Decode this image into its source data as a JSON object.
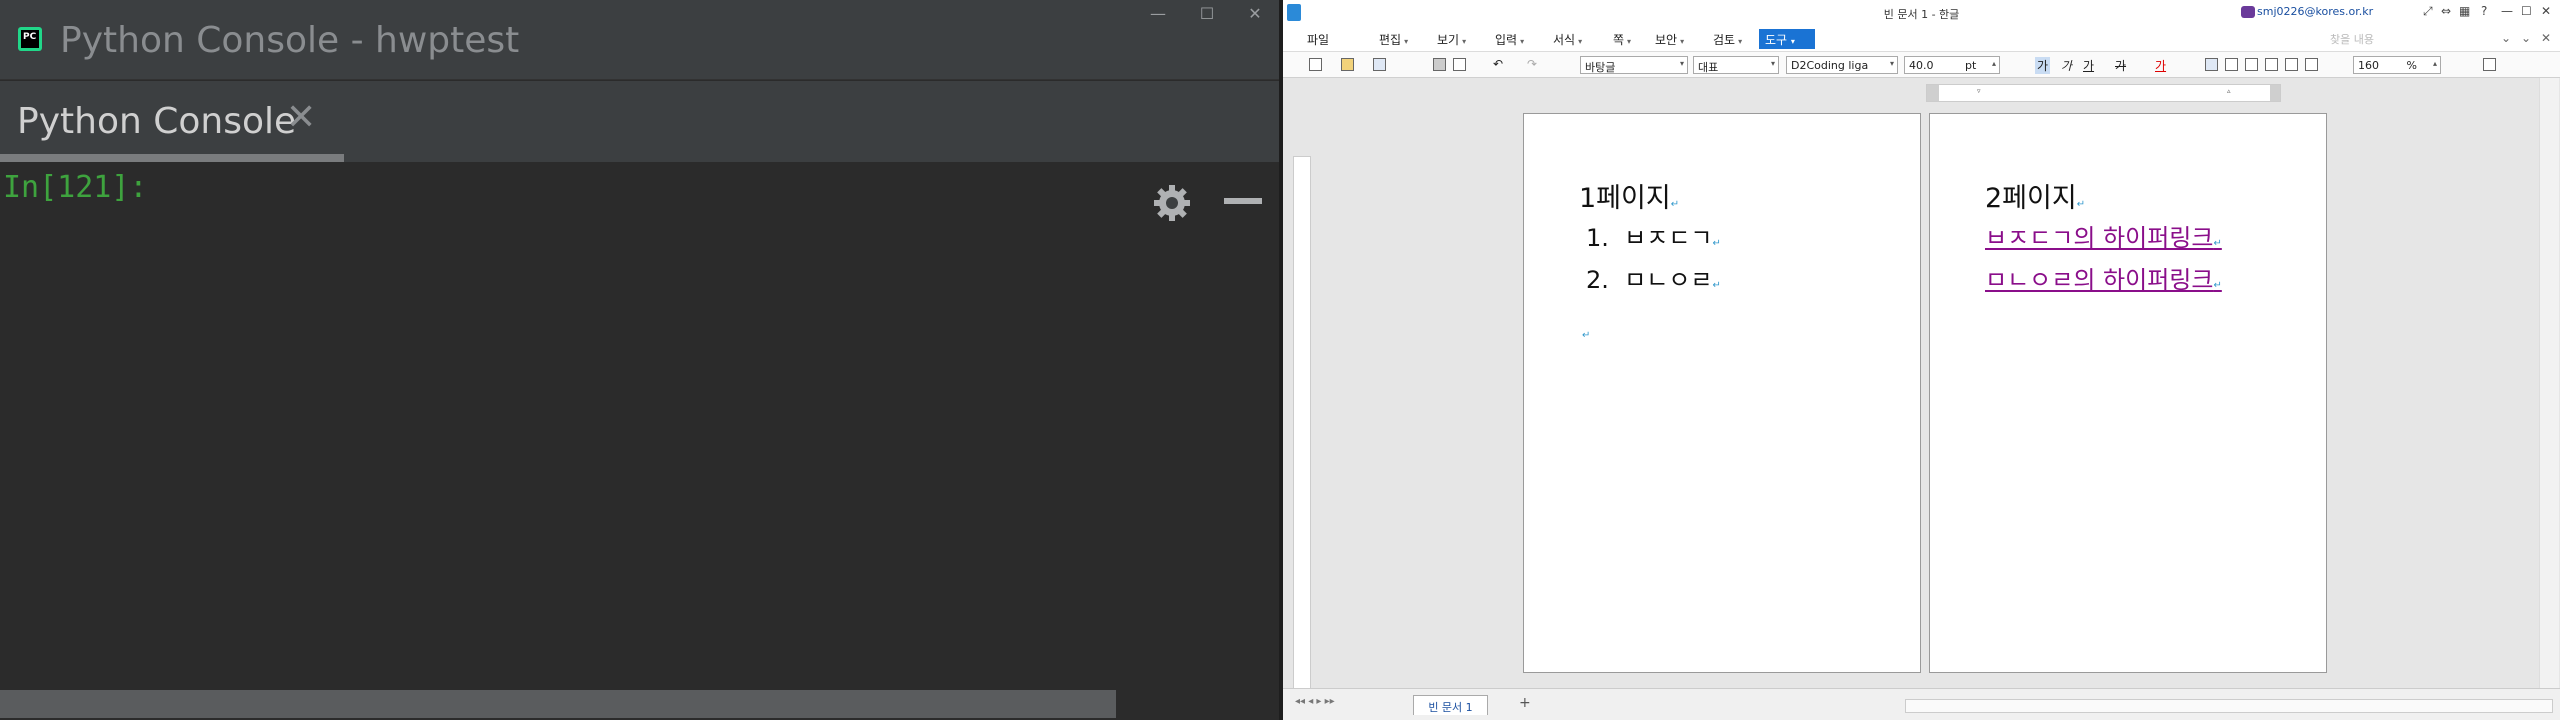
{
  "python": {
    "window_title": "Python Console - hwptest",
    "tab_label": "Python Console",
    "close_glyph": "✕",
    "window_controls": [
      "—",
      "☐",
      "✕"
    ],
    "prompt": "In[121]:"
  },
  "hwp": {
    "window_title": "빈 문서 1 - 한글",
    "user": "smj0226@kores.or.kr",
    "window_controls": [
      "?",
      "—",
      "☐",
      "✕"
    ],
    "menu": [
      "파일",
      "편집",
      "보기",
      "입력",
      "서식",
      "쪽",
      "보안",
      "검토"
    ],
    "menu_active": "도구",
    "search_placeholder": "찾을 내용",
    "toolbar": {
      "style": "바탕글",
      "font_lang": "대표",
      "font": "D2Coding liga",
      "font_size": "40.0",
      "size_unit": "pt",
      "zoom": "160",
      "zoom_unit": "%",
      "bold_glyph": "가",
      "italic_glyph": "가",
      "underline_glyph": "가",
      "strike_glyph": "가",
      "color_glyph": "가"
    },
    "page1": {
      "heading": "1페이지",
      "items": [
        {
          "num": "1.",
          "text": "ㅂㅈㄷㄱ"
        },
        {
          "num": "2.",
          "text": "ㅁㄴㅇㄹ"
        }
      ]
    },
    "page2": {
      "heading": "2페이지",
      "links": [
        "ㅂㅈㄷㄱ의 하이퍼링크",
        "ㅁㄴㅇㄹ의 하이퍼링크"
      ]
    },
    "doc_tab": "빈 문서 1",
    "accent": "#1a73d4",
    "link_color": "#8a0e8a"
  }
}
